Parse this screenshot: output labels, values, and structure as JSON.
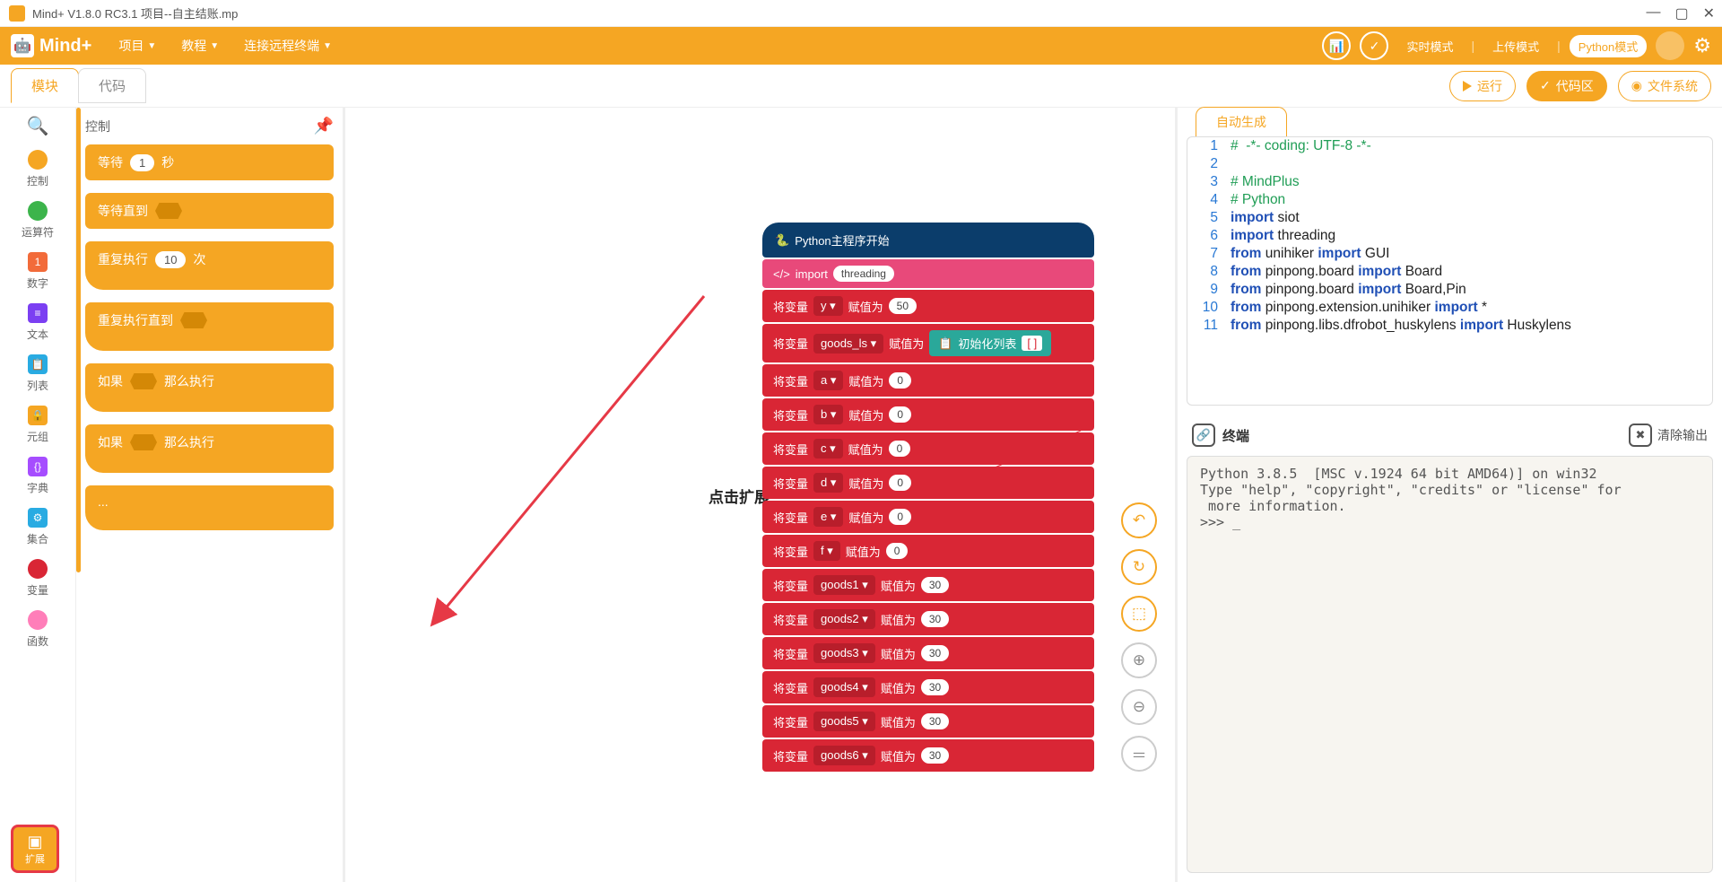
{
  "titlebar": {
    "text": "Mind+ V1.8.0 RC3.1   项目--自主结账.mp"
  },
  "menu": {
    "logo": "Mind+",
    "items": [
      "项目",
      "教程",
      "连接远程终端"
    ],
    "modes": {
      "realtime": "实时模式",
      "upload": "上传模式",
      "python": "Python模式"
    }
  },
  "tabs": {
    "blocks": "模块",
    "code": "代码"
  },
  "actions": {
    "run": "运行",
    "codearea": "代码区",
    "filesystem": "文件系统"
  },
  "categories": {
    "search": "🔍",
    "items": [
      {
        "label": "控制",
        "color": "#f5a623"
      },
      {
        "label": "运算符",
        "color": "#3cb44b"
      },
      {
        "label": "数字",
        "color": "#f26b3a",
        "icon": "1"
      },
      {
        "label": "文本",
        "color": "#7b3ff2",
        "icon": "≡"
      },
      {
        "label": "列表",
        "color": "#29abe2",
        "icon": "📋"
      },
      {
        "label": "元组",
        "color": "#f5a623",
        "icon": "🔒"
      },
      {
        "label": "字典",
        "color": "#a64dff",
        "icon": "{}"
      },
      {
        "label": "集合",
        "color": "#29abe2",
        "icon": "⚙"
      },
      {
        "label": "变量",
        "color": "#d92635"
      },
      {
        "label": "函数",
        "color": "#ff7eb9"
      }
    ],
    "extension": "扩展"
  },
  "palette": {
    "title": "控制",
    "blocks": [
      {
        "text": "等待",
        "oval": "1",
        "suffix": "秒"
      },
      {
        "text": "等待直到",
        "hex": true
      },
      {
        "text": "重复执行",
        "oval": "10",
        "suffix": "次",
        "mouth": true
      },
      {
        "text": "重复执行直到",
        "hex": true,
        "mouth": true
      },
      {
        "text": "如果",
        "hex": true,
        "suffix": "那么执行",
        "mouth": true
      },
      {
        "text": "如果",
        "hex": true,
        "suffix": "那么执行",
        "mouth": true
      },
      {
        "text": "...",
        "mouth": true
      }
    ]
  },
  "annotation": "点击扩展",
  "stack": {
    "hat": "Python主程序开始",
    "import_block": {
      "label": "import",
      "value": "threading"
    },
    "assigns": [
      {
        "var": "y",
        "value": "50"
      },
      {
        "var": "goods_ls",
        "teal": "初始化列表",
        "bracket": "[  ]"
      },
      {
        "var": "a",
        "value": "0"
      },
      {
        "var": "b",
        "value": "0"
      },
      {
        "var": "c",
        "value": "0"
      },
      {
        "var": "d",
        "value": "0"
      },
      {
        "var": "e",
        "value": "0"
      },
      {
        "var": "f",
        "value": "0"
      },
      {
        "var": "goods1",
        "value": "30"
      },
      {
        "var": "goods2",
        "value": "30"
      },
      {
        "var": "goods3",
        "value": "30"
      },
      {
        "var": "goods4",
        "value": "30"
      },
      {
        "var": "goods5",
        "value": "30"
      },
      {
        "var": "goods6",
        "value": "30"
      }
    ],
    "set_label": "将变量",
    "assign_label": "赋值为"
  },
  "code": {
    "tab": "自动生成",
    "lines": [
      {
        "n": 1,
        "cls": "c-comment",
        "t": "#  -*- coding: UTF-8 -*-"
      },
      {
        "n": 2,
        "cls": "",
        "t": ""
      },
      {
        "n": 3,
        "cls": "c-comment",
        "t": "# MindPlus"
      },
      {
        "n": 4,
        "cls": "c-comment",
        "t": "# Python"
      },
      {
        "n": 5,
        "cls": "mix",
        "t": "import siot"
      },
      {
        "n": 6,
        "cls": "mix",
        "t": "import threading"
      },
      {
        "n": 7,
        "cls": "mix",
        "t": "from unihiker import GUI"
      },
      {
        "n": 8,
        "cls": "mix",
        "t": "from pinpong.board import Board"
      },
      {
        "n": 9,
        "cls": "mix",
        "t": "from pinpong.board import Board,Pin"
      },
      {
        "n": 10,
        "cls": "mix",
        "t": "from pinpong.extension.unihiker import *"
      },
      {
        "n": 11,
        "cls": "mix",
        "t": "from pinpong.libs.dfrobot_huskylens import Huskylens"
      }
    ]
  },
  "terminal": {
    "title": "终端",
    "clear": "清除输出",
    "text": "Python 3.8.5  [MSC v.1924 64 bit AMD64)] on win32\nType \"help\", \"copyright\", \"credits\" or \"license\" for\n more information.\n>>> _"
  }
}
